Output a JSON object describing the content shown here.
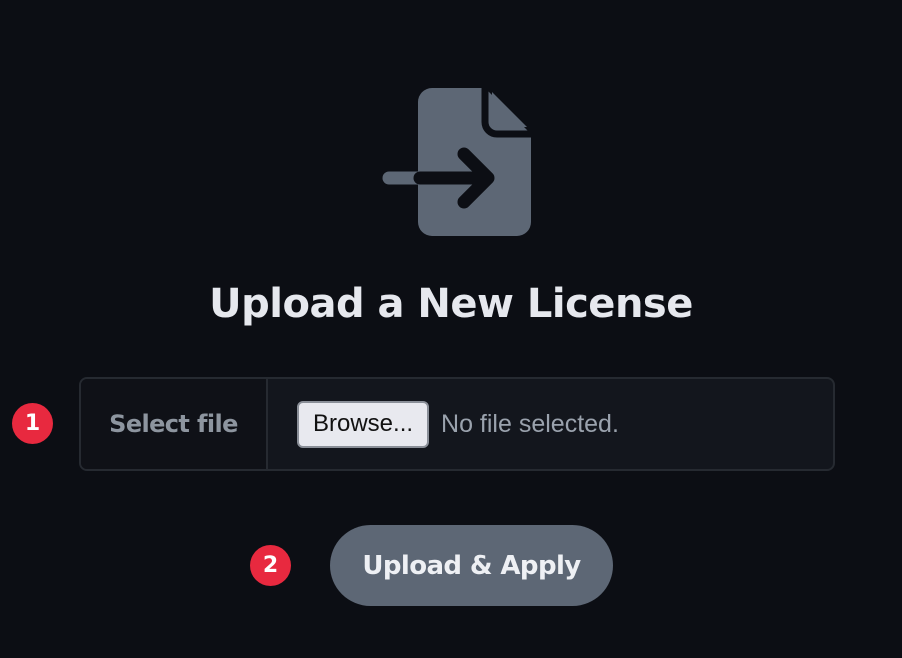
{
  "icon": {
    "name": "file-import-icon",
    "color": "#5d6775"
  },
  "title": "Upload a New License",
  "file_input": {
    "label": "Select file",
    "browse_label": "Browse...",
    "status": "No file selected."
  },
  "submit": {
    "label": "Upload & Apply"
  },
  "steps": {
    "one": "1",
    "two": "2"
  },
  "colors": {
    "background": "#0c0e14",
    "accent_badge": "#e8293f",
    "button": "#5d6775"
  }
}
